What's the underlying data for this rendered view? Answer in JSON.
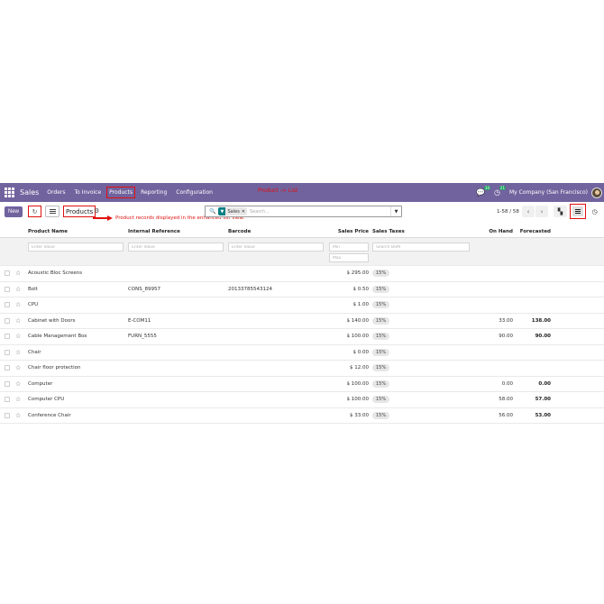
{
  "navbar": {
    "brand": "Sales",
    "menu": [
      "Orders",
      "To Invoice",
      "Products",
      "Reporting",
      "Configuration"
    ],
    "annotation": "Product -> List",
    "badges": {
      "messages": "10",
      "activities": "21"
    },
    "company": "My Company (San Francisco)"
  },
  "control": {
    "new_label": "New",
    "breadcrumb": "Products",
    "annotation": "Product records displayed in the enhanced list view.",
    "search": {
      "facet": "Sales",
      "placeholder": "Search..."
    },
    "pager": "1-58 / 58"
  },
  "table": {
    "columns": {
      "name": "Product Name",
      "ref": "Internal Reference",
      "barcode": "Barcode",
      "price": "Sales Price",
      "taxes": "Sales Taxes",
      "onhand": "On Hand",
      "forecasted": "Forecasted"
    },
    "filters": {
      "name": "Enter Value",
      "ref": "Enter Value",
      "barcode": "Enter Value",
      "min": "Min",
      "max": "Max",
      "taxes": "Search BUM"
    },
    "rows": [
      {
        "name": "Acoustic Bloc Screens",
        "ref": "",
        "barcode": "",
        "price": "$ 295.00",
        "tax": "15%",
        "onhand": "",
        "forecasted": ""
      },
      {
        "name": "Bolt",
        "ref": "CONS_89957",
        "barcode": "20133785543124",
        "price": "$ 0.50",
        "tax": "15%",
        "onhand": "",
        "forecasted": ""
      },
      {
        "name": "CPU",
        "ref": "",
        "barcode": "",
        "price": "$ 1.00",
        "tax": "15%",
        "onhand": "",
        "forecasted": ""
      },
      {
        "name": "Cabinet with Doors",
        "ref": "E-COM11",
        "barcode": "",
        "price": "$ 140.00",
        "tax": "15%",
        "onhand": "33.00",
        "forecasted": "138.00"
      },
      {
        "name": "Cable Management Box",
        "ref": "FURN_5555",
        "barcode": "",
        "price": "$ 100.00",
        "tax": "15%",
        "onhand": "90.00",
        "forecasted": "90.00"
      },
      {
        "name": "Chair",
        "ref": "",
        "barcode": "",
        "price": "$ 0.00",
        "tax": "15%",
        "onhand": "",
        "forecasted": ""
      },
      {
        "name": "Chair floor protection",
        "ref": "",
        "barcode": "",
        "price": "$ 12.00",
        "tax": "15%",
        "onhand": "",
        "forecasted": ""
      },
      {
        "name": "Computer",
        "ref": "",
        "barcode": "",
        "price": "$ 100.00",
        "tax": "15%",
        "onhand": "0.00",
        "forecasted": "0.00"
      },
      {
        "name": "Computer CPU",
        "ref": "",
        "barcode": "",
        "price": "$ 100.00",
        "tax": "15%",
        "onhand": "58.00",
        "forecasted": "57.00"
      },
      {
        "name": "Conference Chair",
        "ref": "",
        "barcode": "",
        "price": "$ 33.00",
        "tax": "15%",
        "onhand": "56.00",
        "forecasted": "53.00"
      }
    ]
  },
  "colors": {
    "brand": "#71639e",
    "annotation": "#e01010",
    "facet": "#017e84"
  },
  "icons": [
    "apps-grid-icon",
    "chat-icon",
    "clock-icon",
    "avatar",
    "reload-icon",
    "list-icon",
    "gear-icon",
    "search-icon",
    "filter-icon",
    "close-icon",
    "caret-down-icon",
    "chevron-left-icon",
    "chevron-right-icon",
    "kanban-icon",
    "list-view-icon",
    "activity-clock-icon",
    "star-icon"
  ]
}
